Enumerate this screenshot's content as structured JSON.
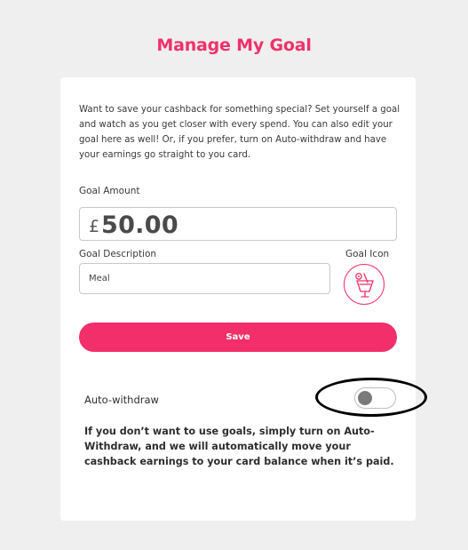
{
  "header": {
    "title": "Manage My Goal"
  },
  "card": {
    "intro": "Want to save your cashback for something special? Set yourself a goal and watch as you get closer with every spend. You can also edit your goal here as well! Or, if you prefer, turn on Auto-withdraw and have your earnings go straight to you card.",
    "goal_amount": {
      "label": "Goal Amount",
      "currency": "£",
      "value": "50.00"
    },
    "goal_description": {
      "label": "Goal Description",
      "value": "Meal"
    },
    "goal_icon": {
      "label": "Goal Icon",
      "icon": "cocktail-glass-icon"
    },
    "save_label": "Save",
    "auto_withdraw": {
      "label": "Auto-withdraw",
      "enabled": false,
      "description": "If you don’t want to use goals, simply turn on Auto-Withdraw, and we will automatically move your cashback earnings to your card balance when it’s paid."
    }
  },
  "colors": {
    "accent": "#f22f6b",
    "background": "#efefef",
    "card": "#ffffff",
    "toggle_knob": "#7a7a7a"
  }
}
